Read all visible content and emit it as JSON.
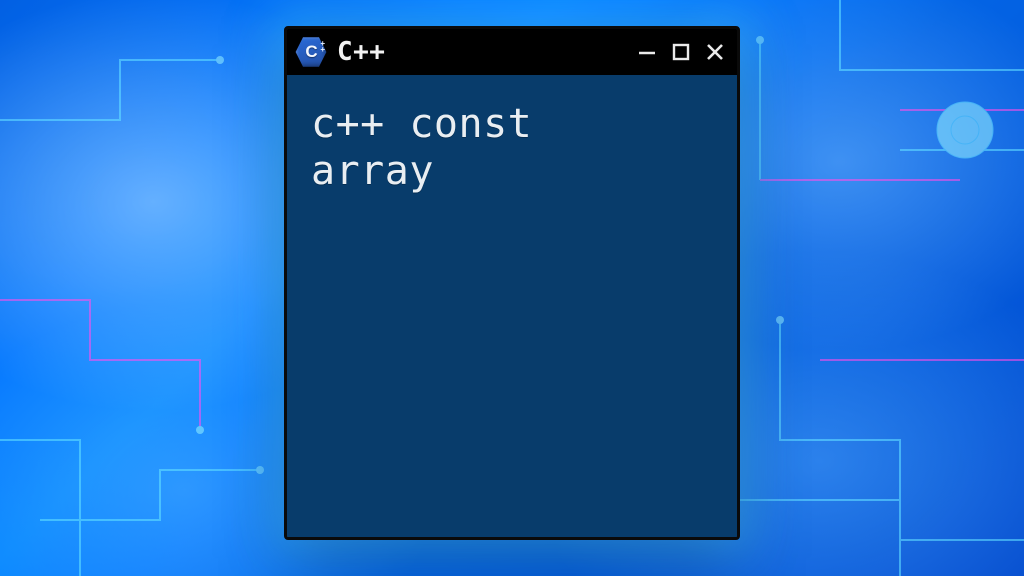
{
  "window": {
    "title": "C++",
    "icon": "cpp-hex-icon",
    "controls": {
      "minimize": "minimize",
      "maximize": "maximize",
      "close": "close"
    }
  },
  "content": {
    "body_text": "c++ const\narray"
  },
  "colors": {
    "window_bg": "#0c3b66",
    "titlebar_bg": "#000000",
    "accent_glow": "#50c8ff"
  }
}
